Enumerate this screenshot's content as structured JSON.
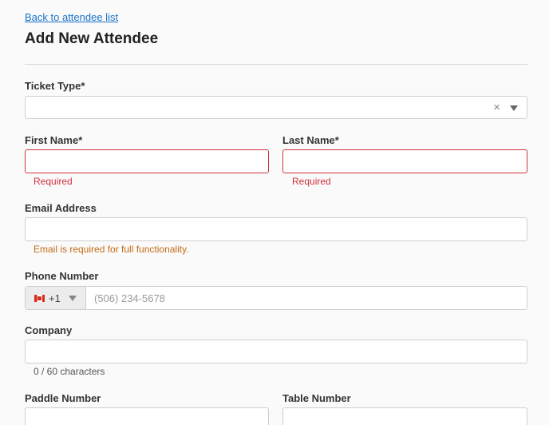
{
  "nav": {
    "back_label": "Back to attendee list"
  },
  "header": {
    "title": "Add New Attendee"
  },
  "form": {
    "ticket_type": {
      "label": "Ticket Type*",
      "value": "",
      "clear_glyph": "×"
    },
    "first_name": {
      "label": "First Name*",
      "value": "",
      "error": "Required"
    },
    "last_name": {
      "label": "Last Name*",
      "value": "",
      "error": "Required"
    },
    "email": {
      "label": "Email Address",
      "value": "",
      "warning": "Email is required for full functionality."
    },
    "phone": {
      "label": "Phone Number",
      "country_code": "+1",
      "flag_icon": "canada-flag-icon",
      "placeholder": "(506) 234-5678",
      "value": ""
    },
    "company": {
      "label": "Company",
      "value": "",
      "counter": "0 / 60 characters"
    },
    "paddle_number": {
      "label": "Paddle Number",
      "value": ""
    },
    "table_number": {
      "label": "Table Number",
      "value": ""
    }
  },
  "colors": {
    "link": "#1a73c9",
    "error": "#d0323c",
    "warning": "#c46a14"
  }
}
